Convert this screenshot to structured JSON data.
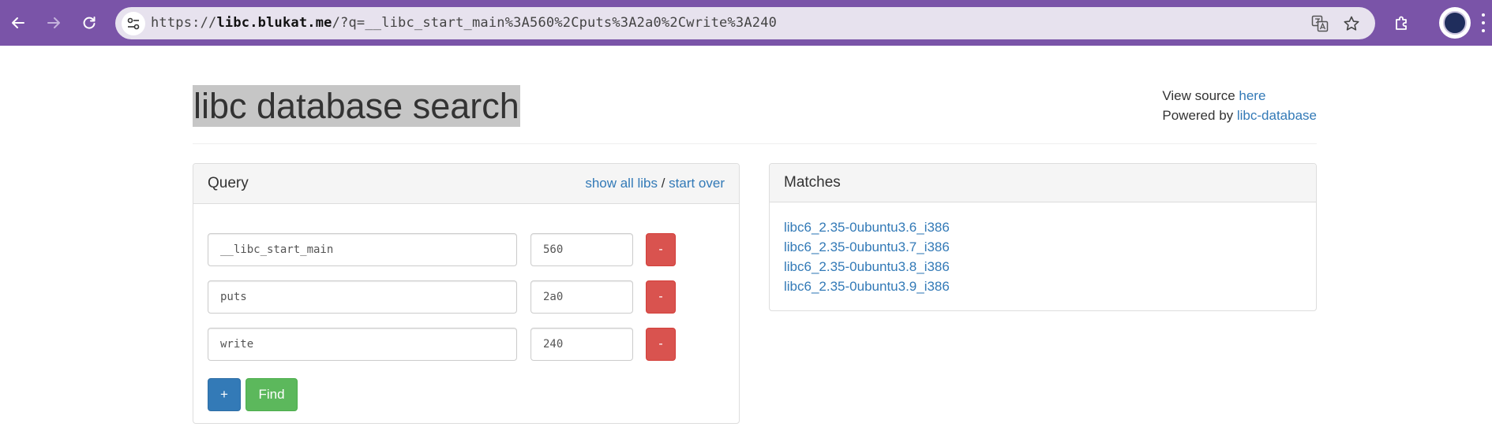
{
  "browser": {
    "url_scheme": "https://",
    "url_host": "libc.blukat.me",
    "url_path": "/?q=__libc_start_main%3A560%2Cputs%3A2a0%2Cwrite%3A240",
    "chrome_color": "#7a54a8"
  },
  "header": {
    "title": "libc database search",
    "view_source_text": "View source ",
    "view_source_link": "here",
    "powered_by_text": "Powered by ",
    "powered_by_link": "libc-database"
  },
  "query_panel": {
    "title": "Query",
    "show_all_libs": "show all libs",
    "separator": " / ",
    "start_over": "start over",
    "rows": [
      {
        "symbol": "__libc_start_main",
        "address": "560",
        "remove_label": "-"
      },
      {
        "symbol": "puts",
        "address": "2a0",
        "remove_label": "-"
      },
      {
        "symbol": "write",
        "address": "240",
        "remove_label": "-"
      }
    ],
    "add_label": "+",
    "find_label": "Find"
  },
  "matches_panel": {
    "title": "Matches",
    "items": [
      "libc6_2.35-0ubuntu3.6_i386",
      "libc6_2.35-0ubuntu3.7_i386",
      "libc6_2.35-0ubuntu3.8_i386",
      "libc6_2.35-0ubuntu3.9_i386"
    ]
  },
  "colors": {
    "link": "#337ab7",
    "danger": "#d9534f",
    "primary": "#337ab7",
    "success": "#5cb85c"
  }
}
